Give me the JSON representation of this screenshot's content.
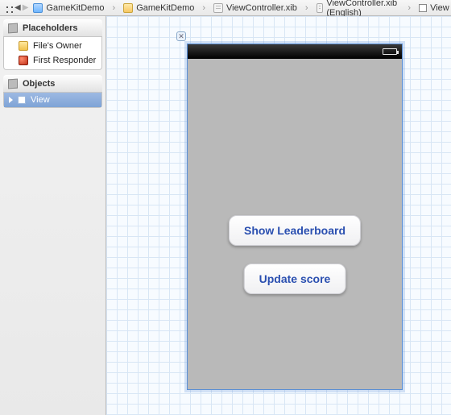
{
  "pathbar": {
    "project": "GameKitDemo",
    "folder": "GameKitDemo",
    "xib": "ViewController.xib",
    "xib_loc": "ViewController.xib (English)",
    "leaf": "View"
  },
  "outline": {
    "placeholders_header": "Placeholders",
    "files_owner": "File's Owner",
    "first_responder": "First Responder",
    "objects_header": "Objects",
    "view_item": "View"
  },
  "device": {
    "buttons": {
      "leaderboard": "Show Leaderboard",
      "update": "Update score"
    }
  }
}
